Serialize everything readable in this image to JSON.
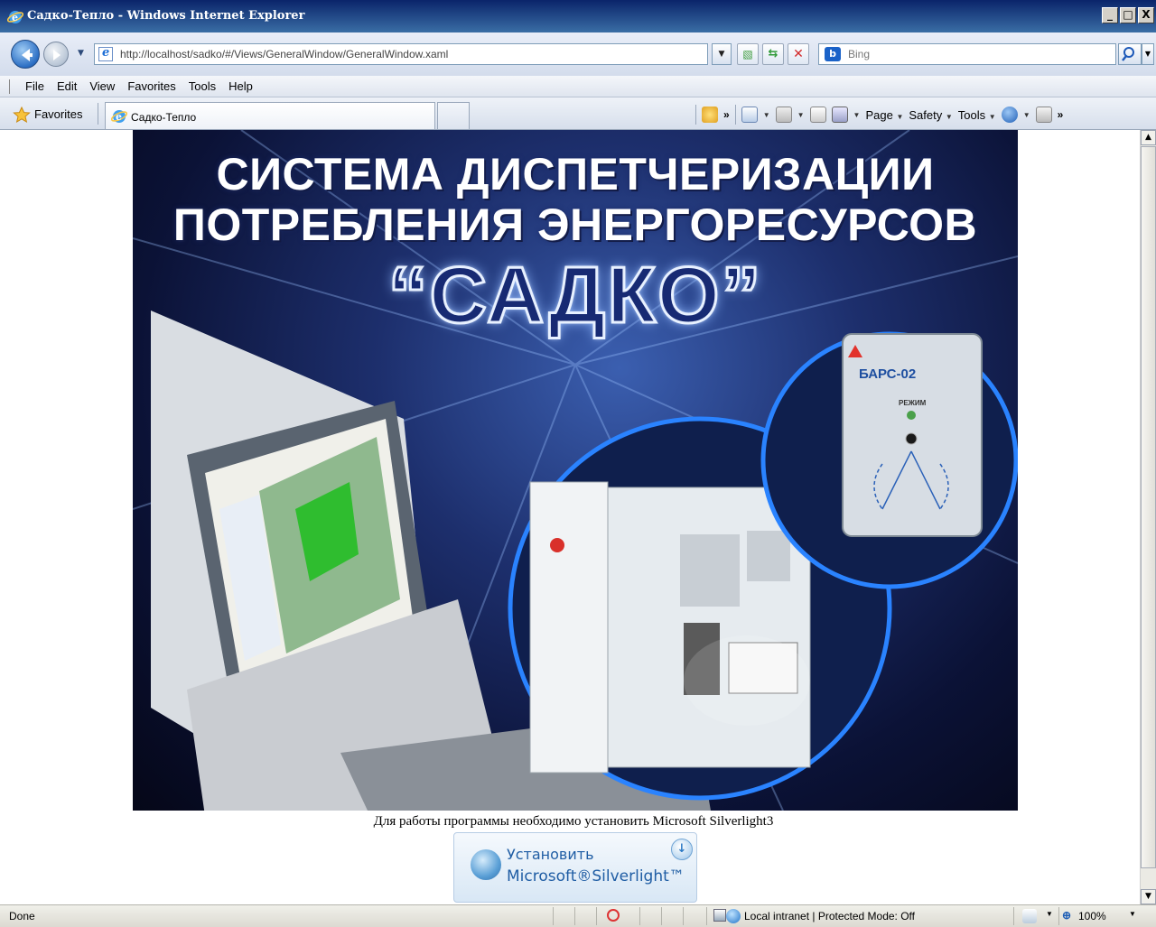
{
  "window": {
    "title": "Садко-Тепло - Windows Internet Explorer",
    "controls": [
      "_",
      "□",
      "X"
    ]
  },
  "address": {
    "url": "http://localhost/sadko/#/Views/GeneralWindow/GeneralWindow.xaml"
  },
  "search": {
    "engine_icon": "b",
    "placeholder": "Bing"
  },
  "menu": {
    "items": [
      "File",
      "Edit",
      "View",
      "Favorites",
      "Tools",
      "Help"
    ]
  },
  "favorites": {
    "label": "Favorites",
    "tab_label": "Садко-Тепло"
  },
  "command_bar": {
    "page": "Page",
    "safety": "Safety",
    "tools": "Tools",
    "overflow": "»"
  },
  "banner": {
    "title_line1": "СИСТЕМА ДИСПЕТЧЕРИЗАЦИИ",
    "title_line2": "ПОТРЕБЛЕНИЯ ЭНЕРГОРЕСУРСОВ",
    "brand": "“САДКО”",
    "device_label": "БАРС-02",
    "device_mode": "РЕЖИМ"
  },
  "page": {
    "notice": "Для работы программы необходимо установить Microsoft Silverlight3",
    "install_line1": "Установить",
    "install_line2": "Microsoft®Silverlight™"
  },
  "status": {
    "text": "Done",
    "zone": "Local intranet | Protected Mode: Off",
    "zoom": "100%"
  },
  "colors": {
    "titlebar": "#0a246a",
    "banner_bg": "#0b1236",
    "silverlight_text": "#1f5da4"
  }
}
